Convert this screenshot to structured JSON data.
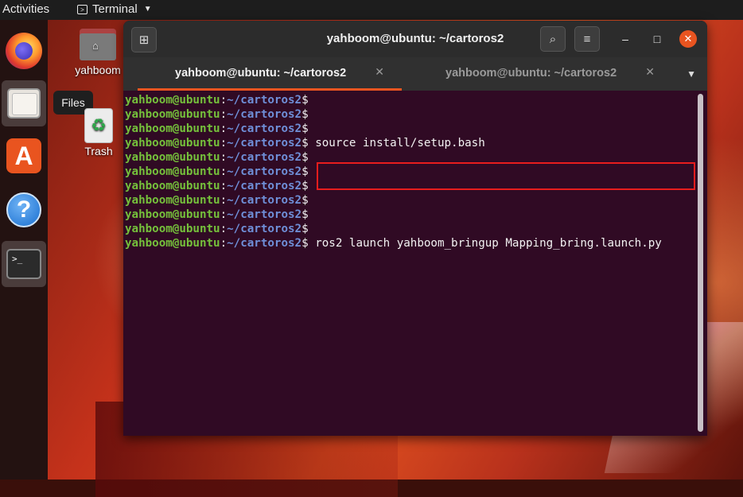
{
  "topbar": {
    "activities": "Activities",
    "app_name": "Terminal"
  },
  "dock": {
    "items": [
      "firefox",
      "files",
      "ubuntu-software",
      "help",
      "terminal"
    ],
    "tooltip": "Files"
  },
  "desktop": {
    "home_label": "yahboom",
    "trash_label": "Trash"
  },
  "terminal": {
    "window_title": "yahboom@ubuntu: ~/cartoros2",
    "tabs": [
      {
        "label": "yahboom@ubuntu: ~/cartoros2",
        "active": true
      },
      {
        "label": "yahboom@ubuntu: ~/cartoros2",
        "active": false
      }
    ],
    "prompt_user": "yahboom@ubuntu",
    "prompt_path": "~/cartoros2",
    "lines": [
      {
        "cmd": ""
      },
      {
        "cmd": ""
      },
      {
        "cmd": ""
      },
      {
        "cmd": " source install/setup.bash"
      },
      {
        "cmd": ""
      },
      {
        "cmd": ""
      },
      {
        "cmd": ""
      },
      {
        "cmd": ""
      },
      {
        "cmd": ""
      },
      {
        "cmd": ""
      },
      {
        "cmd": " ros2 launch yahboom_bringup Mapping_bring.launch.py"
      }
    ],
    "highlighted_line_index": 10
  },
  "colors": {
    "terminal_bg": "#300a24",
    "prompt_user": "#75c13b",
    "prompt_path": "#6f8fd8",
    "accent": "#e95420",
    "highlight": "#e81d1d"
  }
}
